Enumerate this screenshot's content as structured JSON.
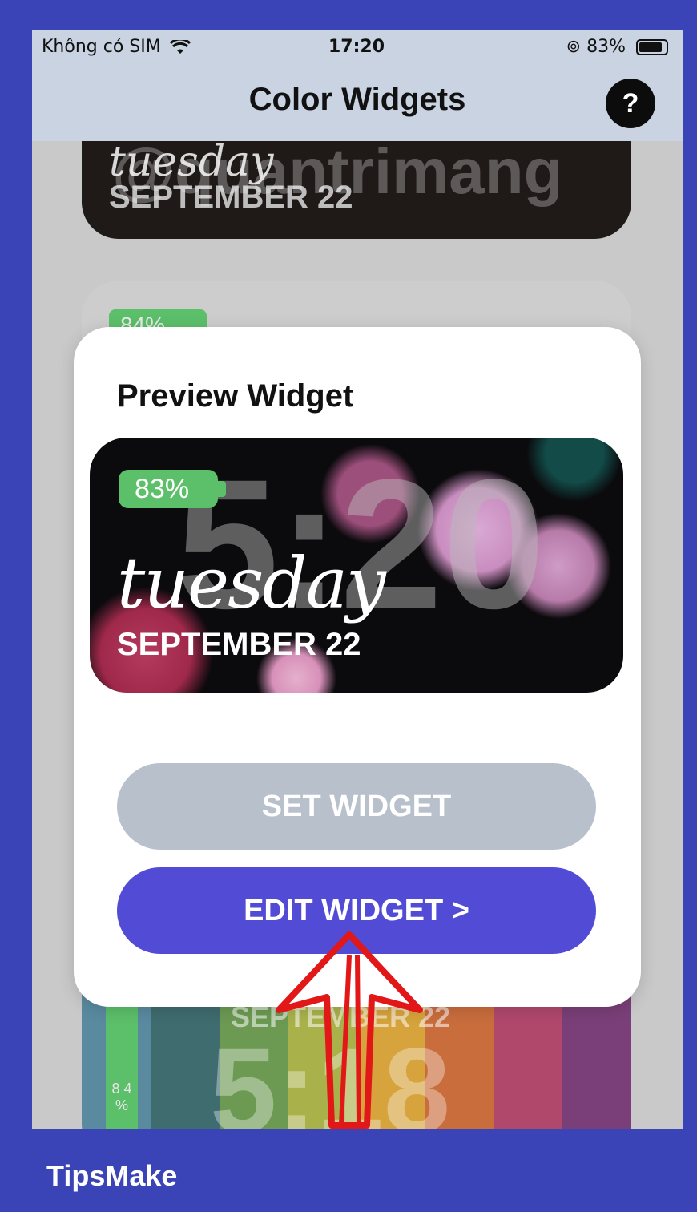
{
  "status_bar": {
    "carrier": "Không có SIM",
    "time": "17:20",
    "battery": "83%"
  },
  "nav": {
    "title": "Color Widgets",
    "help_label": "?"
  },
  "background_cards": {
    "card1_day": "tuesday",
    "card1_date": "SEPTEMBER 22",
    "card2_badge": "84%",
    "card3_date": "SEPTEMBER 22",
    "card3_time": "5:18",
    "card3_badge": "8 4 %"
  },
  "watermark": "@quantrimang",
  "modal": {
    "title": "Preview Widget",
    "preview": {
      "battery": "83%",
      "time": "5:20",
      "day": "tuesday",
      "date": "SEPTEMBER 22"
    },
    "set_label": "SET WIDGET",
    "edit_label": "EDIT WIDGET >"
  },
  "footer": {
    "brand": "TipsMake"
  },
  "colors": {
    "frame": "#3b44b7",
    "accent": "#514bd6",
    "disabled": "#b8c0cc",
    "badge": "#5cbf6a",
    "arrow": "#e21818"
  }
}
